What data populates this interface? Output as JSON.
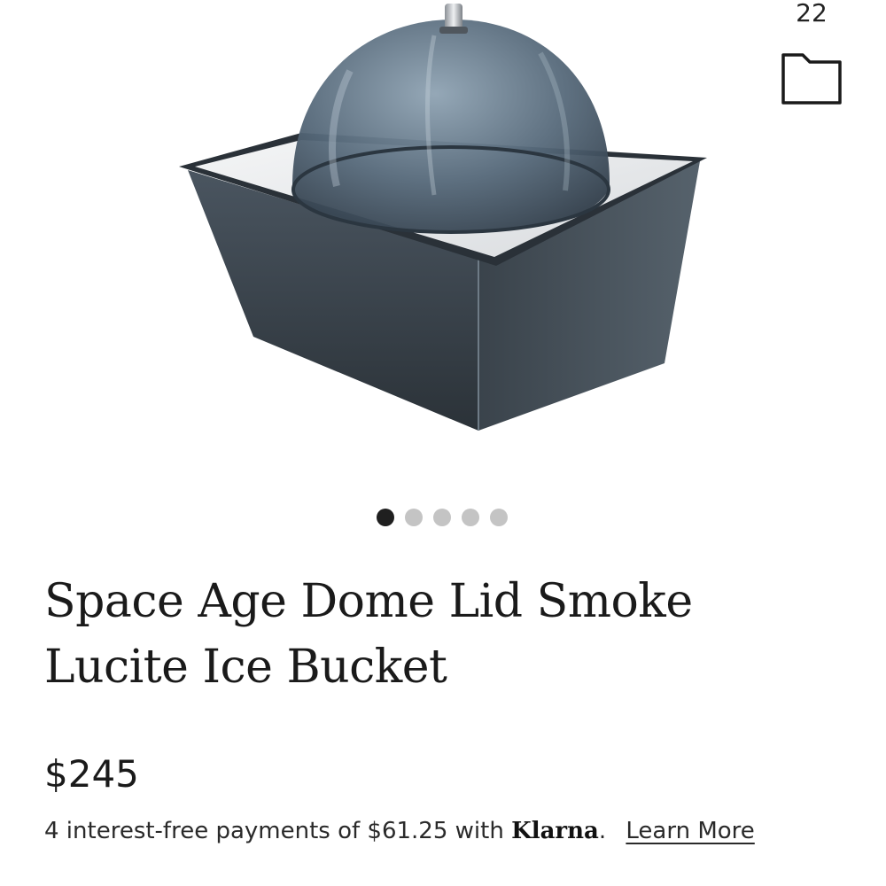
{
  "header": {
    "save_count": "22",
    "folder_icon": "folder-icon"
  },
  "product": {
    "image_alt": "Space Age Dome Lid Smoke Lucite Ice Bucket",
    "title": "Space Age Dome Lid Smoke Lucite Ice Bucket",
    "price": "$245",
    "carousel": {
      "total": 5,
      "active_index": 0
    },
    "financing": {
      "prefix": "4 interest-free payments of $61.25 with ",
      "brand": "Klarna",
      "suffix": ".",
      "link_label": "Learn More"
    }
  },
  "colors": {
    "dot_active": "#1f1f1f",
    "dot_inactive": "#c4c4c4",
    "text": "#1a1a1a"
  }
}
